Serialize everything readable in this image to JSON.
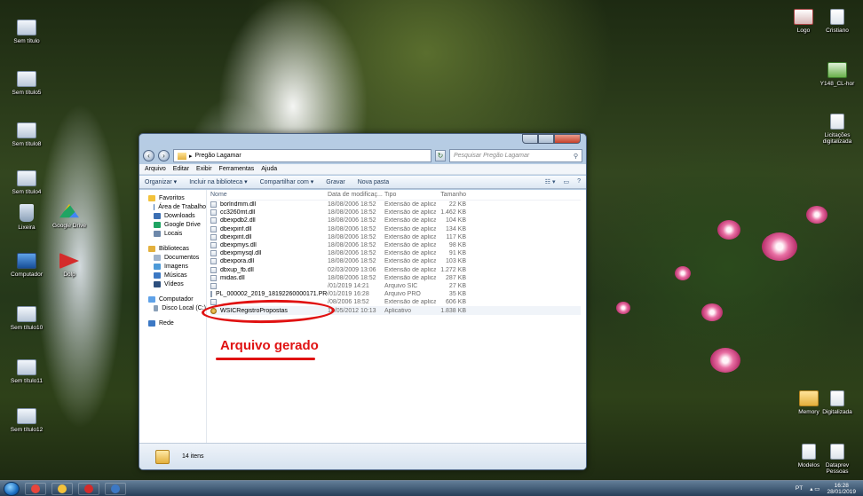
{
  "desktop": {
    "left_icons": [
      {
        "label": "Sem título",
        "icon": "file"
      },
      {
        "label": "Sem título5",
        "icon": "file"
      },
      {
        "label": "Sem título8",
        "icon": "file"
      },
      {
        "label": "Sem título4",
        "icon": "file"
      },
      {
        "label": "Lixeira",
        "icon": "bin"
      },
      {
        "label": "Google Drive",
        "icon": "drive"
      },
      {
        "label": "Computador",
        "icon": "computer"
      },
      {
        "label": "Dolp",
        "icon": "play"
      },
      {
        "label": "Sem título10",
        "icon": "file"
      },
      {
        "label": "Sem título11",
        "icon": "file"
      },
      {
        "label": "Sem título12",
        "icon": "file"
      }
    ],
    "right_icons": [
      {
        "label": "Logo",
        "icon": "logo"
      },
      {
        "label": "Cristiano",
        "icon": "doc"
      },
      {
        "label": "Y148_CL-hor",
        "icon": "excel"
      },
      {
        "label": "Licitações digitalizada",
        "icon": "doc"
      },
      {
        "label": "Memory",
        "icon": "folder"
      },
      {
        "label": "Digitalizada",
        "icon": "doc"
      },
      {
        "label": "Modelos",
        "icon": "doc"
      },
      {
        "label": "Dataprev Pessoas",
        "icon": "doc"
      }
    ]
  },
  "window": {
    "breadcrumb": "Pregão Lagamar",
    "search_placeholder": "Pesquisar Pregão Lagamar",
    "menu": [
      "Arquivo",
      "Editar",
      "Exibir",
      "Ferramentas",
      "Ajuda"
    ],
    "toolbar": {
      "organize": "Organizar ▾",
      "include": "Incluir na biblioteca ▾",
      "share": "Compartilhar com ▾",
      "burn": "Gravar",
      "new_folder": "Nova pasta"
    },
    "nav": [
      {
        "label": "Favoritos",
        "level": 0,
        "color": "#f3c23a"
      },
      {
        "label": "Área de Trabalho",
        "level": 1,
        "color": "#3b6fb3"
      },
      {
        "label": "Downloads",
        "level": 1,
        "color": "#3b6fb3"
      },
      {
        "label": "Google Drive",
        "level": 1,
        "color": "#1fa463"
      },
      {
        "label": "Locais",
        "level": 1,
        "color": "#6d88aa"
      },
      {
        "label": "Bibliotecas",
        "level": 0,
        "color": "#e3b03c"
      },
      {
        "label": "Documentos",
        "level": 1,
        "color": "#9fb3cc"
      },
      {
        "label": "Imagens",
        "level": 1,
        "color": "#4d9ad8"
      },
      {
        "label": "Músicas",
        "level": 1,
        "color": "#3c78c4"
      },
      {
        "label": "Vídeos",
        "level": 1,
        "color": "#2d4f7e"
      },
      {
        "label": "Computador",
        "level": 0,
        "color": "#5fa2e8"
      },
      {
        "label": "Disco Local (C:)",
        "level": 1,
        "color": "#8aa0b8"
      },
      {
        "label": "Rede",
        "level": 0,
        "color": "#3c78c4"
      }
    ],
    "columns": {
      "name": "Nome",
      "date": "Data de modificaç...",
      "type": "Tipo",
      "size": "Tamanho"
    },
    "files": [
      {
        "name": "borlndmm.dll",
        "date": "18/08/2006 18:52",
        "type": "Extensão de aplica...",
        "size": "22 KB",
        "icon": "file"
      },
      {
        "name": "cc3260mt.dll",
        "date": "18/08/2006 18:52",
        "type": "Extensão de aplica...",
        "size": "1.462 KB",
        "icon": "file"
      },
      {
        "name": "dbexpdb2.dll",
        "date": "18/08/2006 18:52",
        "type": "Extensão de aplica...",
        "size": "104 KB",
        "icon": "file"
      },
      {
        "name": "dbexpinf.dll",
        "date": "18/08/2006 18:52",
        "type": "Extensão de aplica...",
        "size": "134 KB",
        "icon": "file"
      },
      {
        "name": "dbexpint.dll",
        "date": "18/08/2006 18:52",
        "type": "Extensão de aplica...",
        "size": "117 KB",
        "icon": "file"
      },
      {
        "name": "dbexpmys.dll",
        "date": "18/08/2006 18:52",
        "type": "Extensão de aplica...",
        "size": "98 KB",
        "icon": "file"
      },
      {
        "name": "dbexpmysql.dll",
        "date": "18/08/2006 18:52",
        "type": "Extensão de aplica...",
        "size": "91 KB",
        "icon": "file"
      },
      {
        "name": "dbexpora.dll",
        "date": "18/08/2006 18:52",
        "type": "Extensão de aplica...",
        "size": "103 KB",
        "icon": "file"
      },
      {
        "name": "dbxup_fb.dll",
        "date": "02/03/2009 13:06",
        "type": "Extensão de aplica...",
        "size": "1.272 KB",
        "icon": "file"
      },
      {
        "name": "midas.dll",
        "date": "18/08/2006 18:52",
        "type": "Extensão de aplica...",
        "size": "287 KB",
        "icon": "file"
      },
      {
        "name": "",
        "date": "/01/2019 14:21",
        "type": "Arquivo SIC",
        "size": "27 KB",
        "icon": "file"
      },
      {
        "name": "PL_000002_2019_18192260000171.PRO",
        "date": "/01/2019 16:28",
        "type": "Arquivo PRO",
        "size": "35 KB",
        "icon": "file"
      },
      {
        "name": "",
        "date": "/08/2006 18:52",
        "type": "Extensão de aplica...",
        "size": "606 KB",
        "icon": "file"
      },
      {
        "name": "WSICRegistroPropostas",
        "date": "18/05/2012 10:13",
        "type": "Aplicativo",
        "size": "1.838 KB",
        "icon": "app"
      }
    ],
    "status": "14 itens"
  },
  "annotation": {
    "text": "Arquivo gerado",
    "color": "#e01212"
  },
  "taskbar": {
    "apps": [
      {
        "name": "chrome",
        "color": "#e8453c"
      },
      {
        "name": "explorer",
        "color": "#f3c23a"
      },
      {
        "name": "pdf-reader",
        "color": "#d42b2b"
      },
      {
        "name": "app",
        "color": "#3c78c4"
      }
    ],
    "lang": "PT",
    "time": "16:28",
    "date": "28/01/2019"
  }
}
